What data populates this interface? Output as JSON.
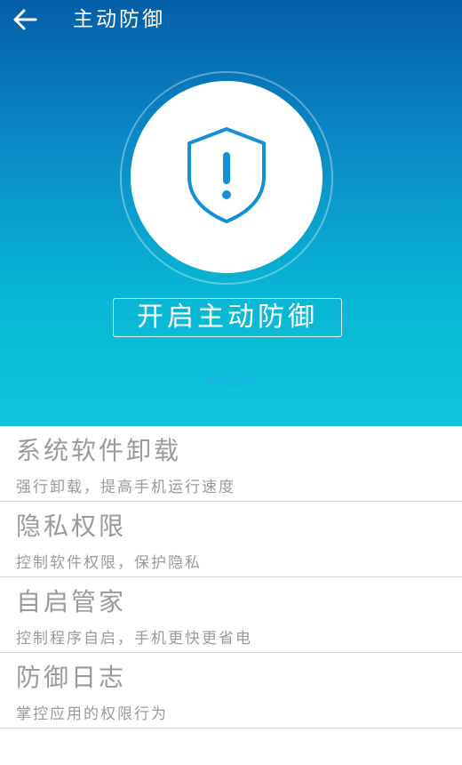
{
  "header": {
    "title": "主动防御",
    "back_icon": "arrow-left-icon"
  },
  "hero": {
    "icon": "shield-exclamation-icon",
    "enable_button_label": "开启主动防御",
    "status_text": "未开启防护",
    "colors": {
      "gradient_top": "#045ea8",
      "gradient_bottom": "#10c6dc",
      "shield_stroke": "#1391d6"
    }
  },
  "features": [
    {
      "title": "系统软件卸载",
      "description": "强行卸载，提高手机运行速度"
    },
    {
      "title": "隐私权限",
      "description": "控制软件权限，保护隐私"
    },
    {
      "title": "自启管家",
      "description": "控制程序自启，手机更快更省电"
    },
    {
      "title": "防御日志",
      "description": "掌控应用的权限行为"
    }
  ]
}
